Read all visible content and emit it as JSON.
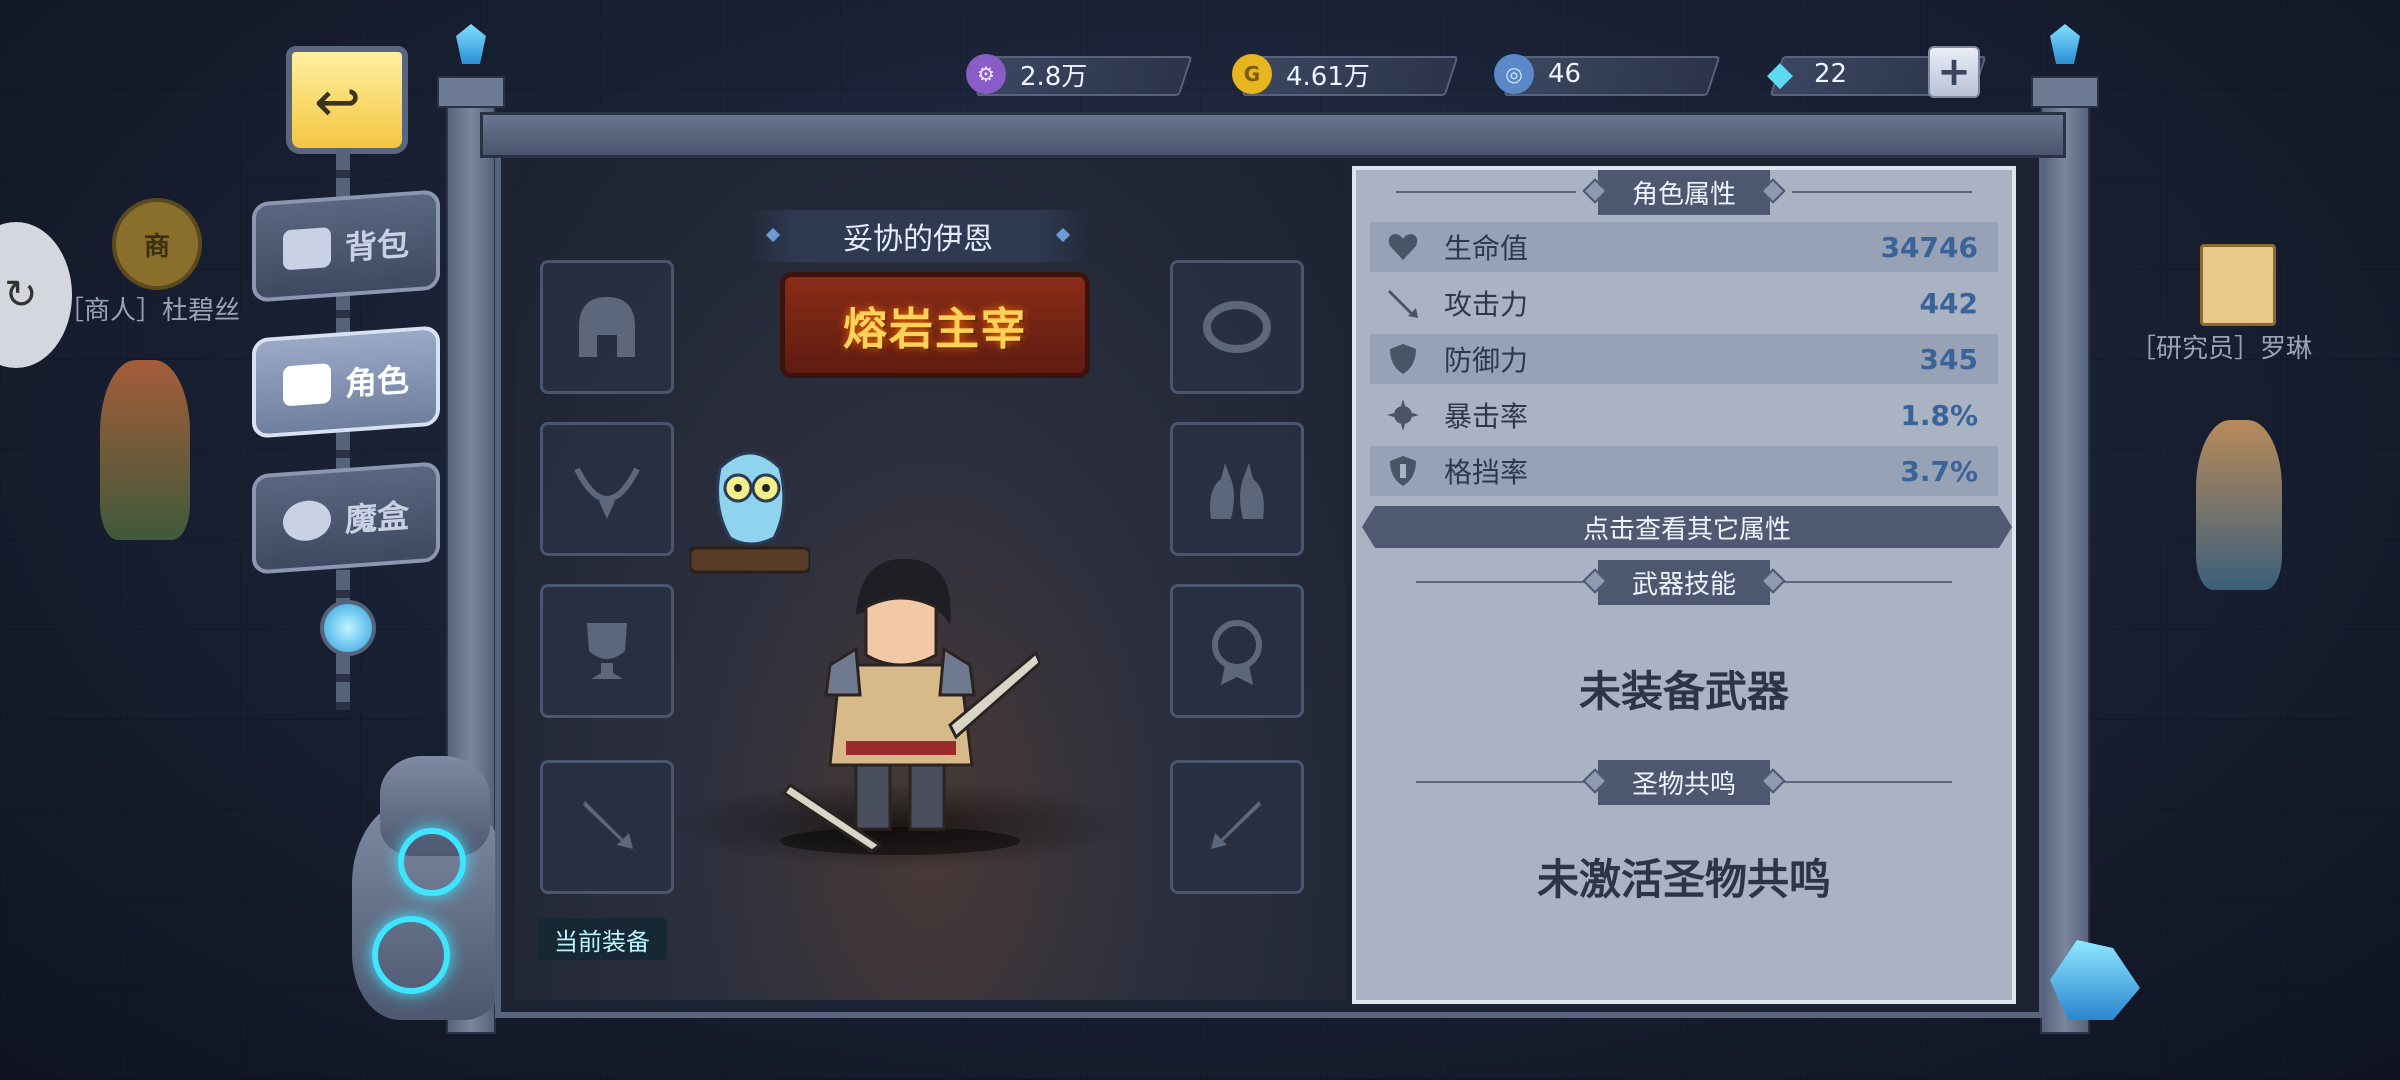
{
  "resources": [
    {
      "name": "purple-coin",
      "value": "2.8万",
      "color": "#8a5cc8",
      "icon_glyph": "⚙"
    },
    {
      "name": "gold-coin",
      "value": "4.61万",
      "color": "#e7b51e",
      "icon_glyph": "G"
    },
    {
      "name": "blue-token",
      "value": "46",
      "color": "#5a88c9",
      "icon_glyph": "◎"
    },
    {
      "name": "diamond",
      "value": "22",
      "color": "#5fd8f2",
      "icon_glyph": "◆"
    }
  ],
  "plus_label": "+",
  "nav": {
    "items": [
      {
        "label": "背包",
        "active": false
      },
      {
        "label": "角色",
        "active": true
      },
      {
        "label": "魔盒",
        "active": false
      }
    ]
  },
  "npcs": {
    "merchant_label": "［商人］杜碧丝",
    "researcher_label": "［研究员］罗琳",
    "shop_sign": "商"
  },
  "side_button_glyph": "↻",
  "current_equip_label": "当前装备",
  "character": {
    "name": "妥协的伊恩",
    "title": "熔岩主宰"
  },
  "attributes": {
    "title": "角色属性",
    "stats": [
      {
        "label": "生命值",
        "value": "34746",
        "icon": "heart-icon"
      },
      {
        "label": "攻击力",
        "value": "442",
        "icon": "sword-icon"
      },
      {
        "label": "防御力",
        "value": "345",
        "icon": "shield-icon"
      },
      {
        "label": "暴击率",
        "value": "1.8%",
        "icon": "crit-icon"
      },
      {
        "label": "格挡率",
        "value": "3.7%",
        "icon": "block-icon"
      }
    ],
    "more_label": "点击查看其它属性"
  },
  "weapon_skill": {
    "title": "武器技能",
    "text": "未装备武器"
  },
  "relic": {
    "title": "圣物共鸣",
    "text": "未激活圣物共鸣"
  }
}
